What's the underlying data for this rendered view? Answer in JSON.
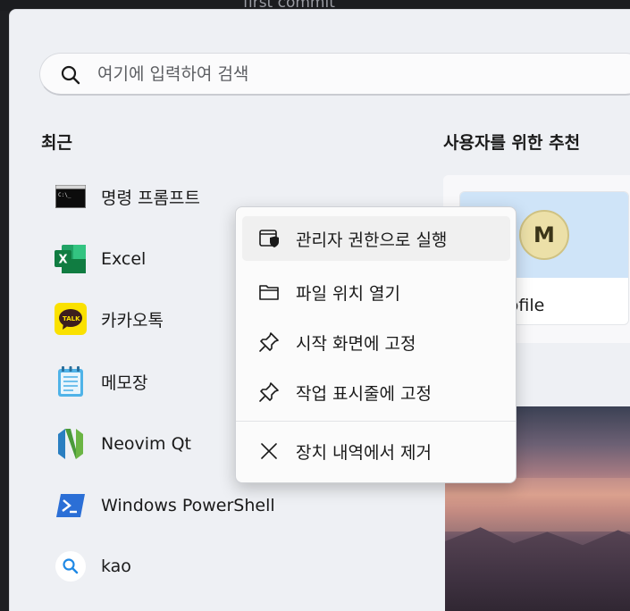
{
  "background": {
    "title": "first commit"
  },
  "search": {
    "placeholder": "여기에 입력하여 검색",
    "icon": "search-icon"
  },
  "recent": {
    "title": "최근",
    "items": [
      {
        "label": "명령 프롬프트",
        "icon": "command-prompt-icon"
      },
      {
        "label": "Excel",
        "icon": "excel-icon"
      },
      {
        "label": "카카오톡",
        "icon": "kakaotalk-icon"
      },
      {
        "label": "메모장",
        "icon": "notepad-icon"
      },
      {
        "label": "Neovim Qt",
        "icon": "neovim-icon"
      },
      {
        "label": "Windows PowerShell",
        "icon": "powershell-icon"
      },
      {
        "label": "kao",
        "icon": "search-result-icon"
      }
    ]
  },
  "recommended": {
    "title": "사용자를 위한 추천",
    "card": {
      "avatar_letter": "M",
      "label": "y Profile"
    }
  },
  "context_menu": {
    "items": [
      {
        "label": "관리자 권한으로 실행",
        "icon": "shield-icon"
      },
      {
        "label": "파일 위치 열기",
        "icon": "folder-icon"
      },
      {
        "label": "시작 화면에 고정",
        "icon": "pin-icon"
      },
      {
        "label": "작업 표시줄에 고정",
        "icon": "pin-icon"
      },
      {
        "label": "장치 내역에서 제거",
        "icon": "close-icon"
      }
    ]
  },
  "colors": {
    "panel": "#eef0f4",
    "excel_green": "#107c41",
    "kakao_yellow": "#fae100",
    "powershell_blue": "#2b6fd6",
    "avatar_bg": "#ece0a8"
  }
}
